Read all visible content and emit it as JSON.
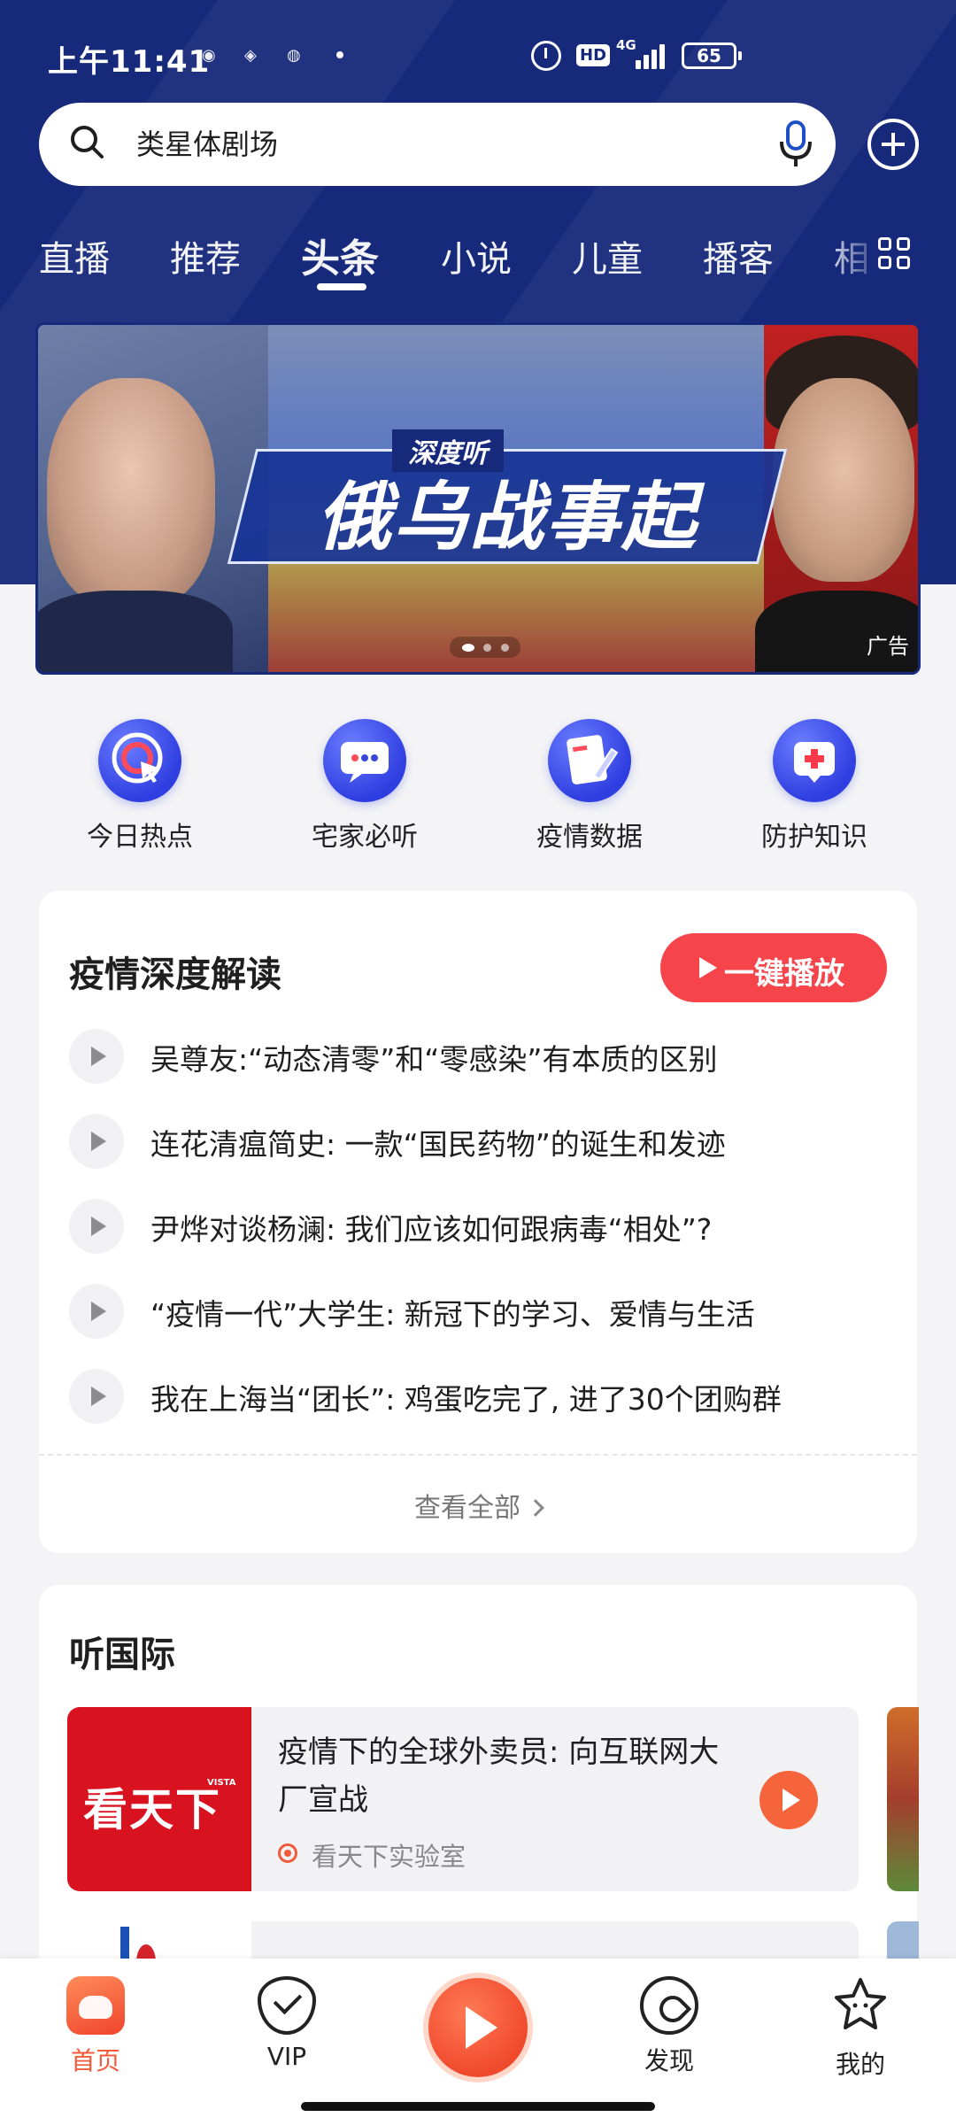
{
  "status_bar": {
    "time": "上午11:41",
    "network": "4G",
    "hd": "HD",
    "battery": "65"
  },
  "search": {
    "query": "类星体剧场"
  },
  "tabs": [
    {
      "label": "直播"
    },
    {
      "label": "推荐"
    },
    {
      "label": "头条",
      "active": true
    },
    {
      "label": "小说"
    },
    {
      "label": "儿童"
    },
    {
      "label": "播客"
    },
    {
      "label": "相"
    }
  ],
  "banner": {
    "subtitle": "深度听",
    "title": "俄乌战事起",
    "ad_label": "广告"
  },
  "quick_entries": [
    {
      "label": "今日热点",
      "icon": "target-icon"
    },
    {
      "label": "宅家必听",
      "icon": "chat-bubble-icon"
    },
    {
      "label": "疫情数据",
      "icon": "document-pen-icon"
    },
    {
      "label": "防护知识",
      "icon": "medical-kit-icon"
    }
  ],
  "section_epidemic": {
    "title": "疫情深度解读",
    "play_all": "一键播放",
    "items": [
      "吴尊友:“动态清零”和“零感染”有本质的区别",
      "连花清瘟简史: 一款“国民药物”的诞生和发迹",
      "尹烨对谈杨澜: 我们应该如何跟病毒“相处”?",
      "“疫情一代”大学生: 新冠下的学习、爱情与生活",
      "我在上海当“团长”: 鸡蛋吃完了, 进了30个团购群"
    ],
    "see_all": "查看全部"
  },
  "section_international": {
    "title": "听国际",
    "card": {
      "thumb_logo": "看天下",
      "thumb_tag": "VISTA",
      "title": "疫情下的全球外卖员: 向互联网大厂宣战",
      "source": "看天下实验室"
    }
  },
  "bottom_nav": [
    {
      "label": "首页",
      "icon": "home-icon",
      "active": true
    },
    {
      "label": "VIP",
      "icon": "vip-icon"
    },
    {
      "label": "发现",
      "icon": "discover-icon"
    },
    {
      "label": "我的",
      "icon": "profile-icon"
    }
  ],
  "colors": {
    "header_blue": "#16297a",
    "accent_red": "#f5454b",
    "accent_orange": "#f15a3a"
  }
}
